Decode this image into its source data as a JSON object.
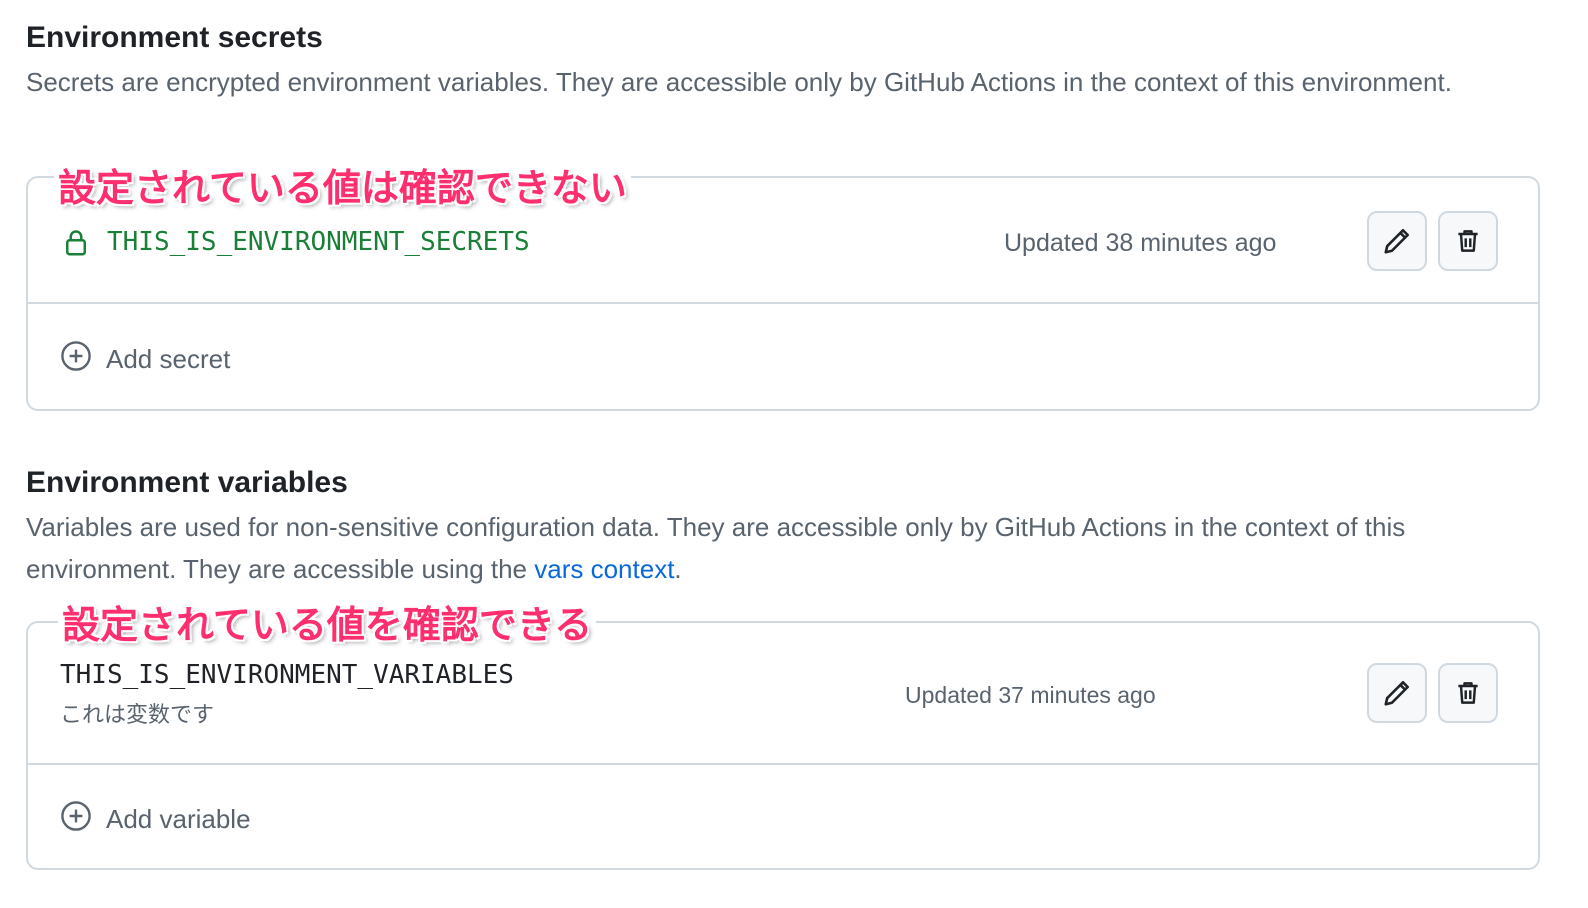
{
  "secrets": {
    "title": "Environment secrets",
    "description": "Secrets are encrypted environment variables. They are accessible only by GitHub Actions in the context of this environment.",
    "annotation": "設定されている値は確認できない",
    "item": {
      "name": "THIS_IS_ENVIRONMENT_SECRETS",
      "updated": "Updated 38 minutes ago"
    },
    "add_label": "Add secret"
  },
  "variables": {
    "title": "Environment variables",
    "description_prefix": "Variables are used for non-sensitive configuration data. They are accessible only by GitHub Actions in the context of this environment. They are accessible using the ",
    "description_link": "vars context",
    "description_suffix": ".",
    "annotation": "設定されている値を確認できる",
    "item": {
      "name": "THIS_IS_ENVIRONMENT_VARIABLES",
      "value": "これは変数です",
      "updated": "Updated 37 minutes ago"
    },
    "add_label": "Add variable"
  },
  "icons": {
    "lock": "lock-icon",
    "edit": "pencil-icon",
    "delete": "trash-icon",
    "add": "plus-circle-icon"
  },
  "colors": {
    "secret_name": "#1a7f37",
    "link": "#0969da",
    "annotation": "#ff2e6e",
    "border": "#d1d9e0",
    "muted_text": "#59636e"
  }
}
